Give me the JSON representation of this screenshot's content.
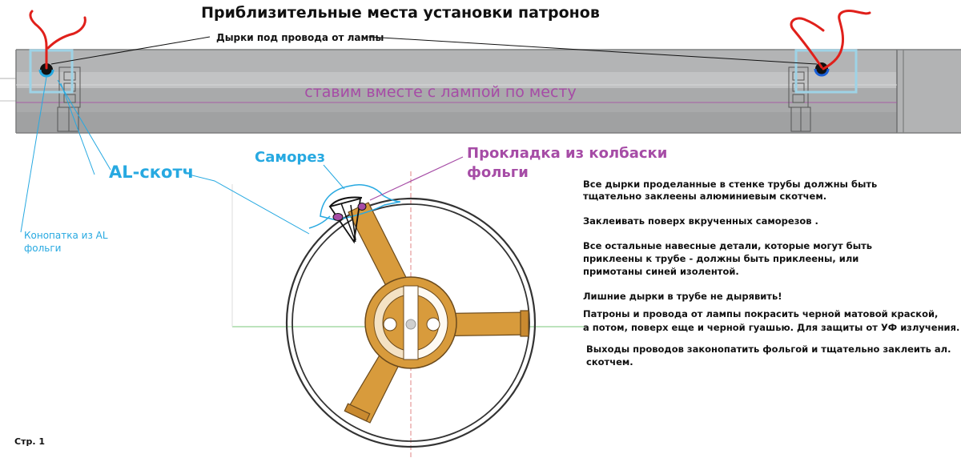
{
  "title": "Приблизительные места установки патронов",
  "labels": {
    "holes": "Дырки под провода от лампы",
    "place": "ставим вместе с лампой   по месту",
    "al_tape": "AL-скотч",
    "screw": "Саморез",
    "gasket_line1": "Прокладка из колбаски",
    "gasket_line2": "фольги",
    "caulk_line1": "Конопатка из AL",
    "caulk_line2": "фольги",
    "page": "Стр. 1"
  },
  "notes": [
    "Все дырки проделанные в стенке трубы должны быть",
    "тщательно заклеены алюминиевым скотчем.",
    "Заклеивать поверх вкрученных саморезов .",
    "Все остальные навесные детали, которые могут быть",
    "приклеены к трубе - должны быть приклеены, или",
    "примотаны синей изолентой.",
    "Лишние дырки в трубе не дырявить!",
    "Патроны и провода от лампы покрасить черной матовой краской,",
    "а потом, поверх еще и черной гуашью. Для защиты от УФ излучения.",
    "Выходы проводов законопатить фольгой и тщательно заклеить ал.",
    "скотчем."
  ],
  "colors": {
    "tube": "#a9aaab",
    "cyan": "#27a9e1",
    "purple": "#a64ca6",
    "red": "#e0201b",
    "box": "#9ed3e6",
    "wood": "#d89b3c",
    "blue": "#1a5fd6"
  }
}
